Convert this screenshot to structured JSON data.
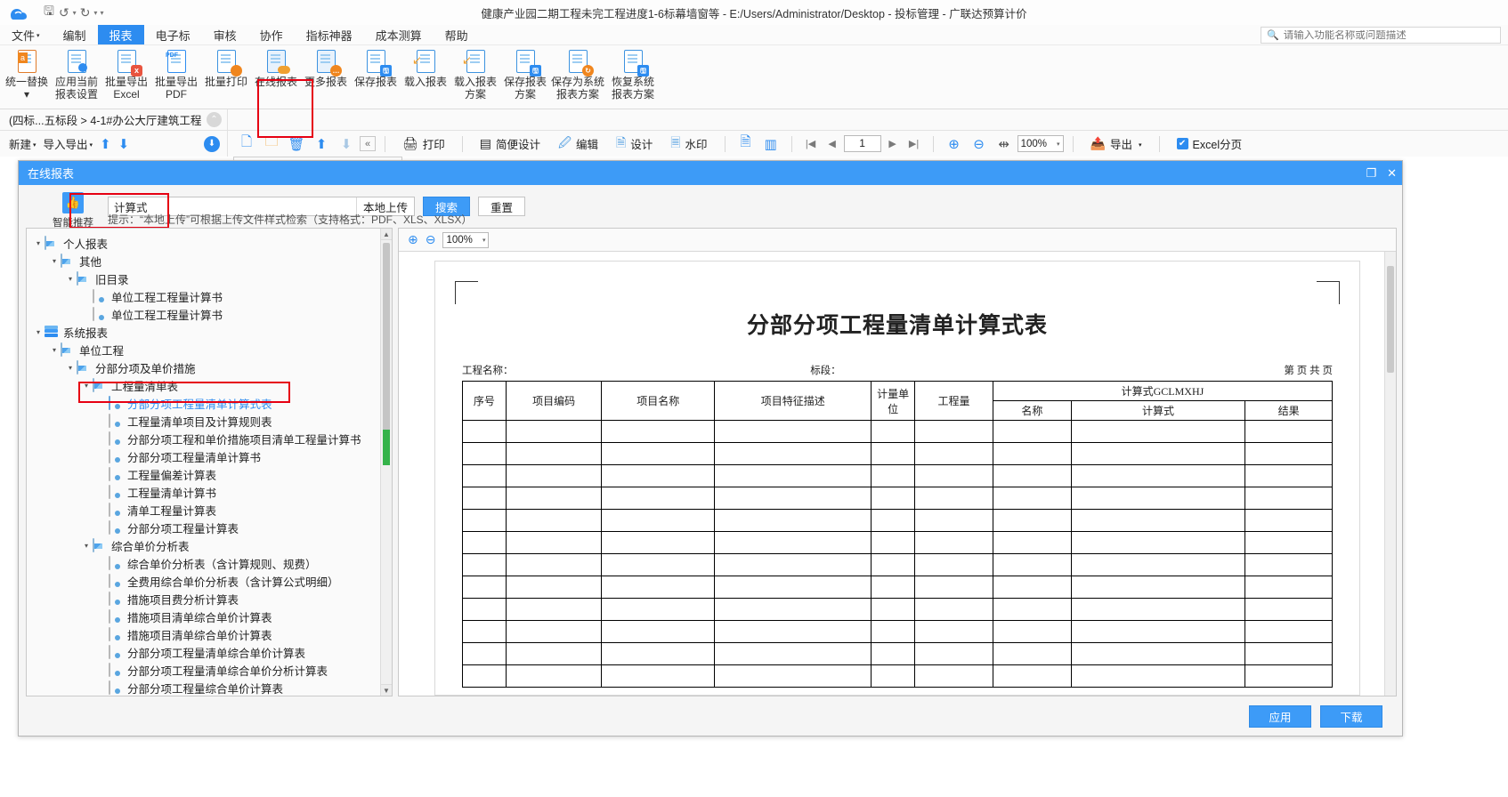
{
  "window": {
    "title": "健康产业园二期工程未完工程进度1-6标幕墙窗等 - E:/Users/Administrator/Desktop - 投标管理 - 广联达预算计价",
    "logo": "cloud-logo-icon"
  },
  "quick_access": [
    "save-icon",
    "undo-icon",
    "redo-icon",
    "customize-icon"
  ],
  "global_search": {
    "placeholder": "请输入功能名称或问题描述",
    "icon": "search-icon"
  },
  "menu": {
    "items": [
      {
        "label": "文件",
        "caret": "▾",
        "active": false
      },
      {
        "label": "编制",
        "active": false
      },
      {
        "label": "报表",
        "active": true
      },
      {
        "label": "电子标",
        "active": false
      },
      {
        "label": "审核",
        "active": false
      },
      {
        "label": "协作",
        "active": false
      },
      {
        "label": "指标神器",
        "active": false
      },
      {
        "label": "成本测算",
        "active": false
      },
      {
        "label": "帮助",
        "active": false
      }
    ]
  },
  "ribbon": {
    "buttons": [
      {
        "label": "统一替换\n▾",
        "icon": "replace-icon",
        "highlight": false
      },
      {
        "label": "应用当前\n报表设置",
        "icon": "apply-settings-icon",
        "highlight": false
      },
      {
        "label": "批量导出\nExcel",
        "icon": "export-excel-icon",
        "highlight": false
      },
      {
        "label": "批量导出\nPDF",
        "icon": "export-pdf-icon",
        "highlight": false
      },
      {
        "label": "批量打印",
        "icon": "batch-print-icon",
        "highlight": false
      },
      {
        "label": "在线报表",
        "icon": "online-report-icon",
        "highlight": true
      },
      {
        "label": "更多报表",
        "icon": "more-report-icon",
        "highlight": false
      },
      {
        "label": "保存报表",
        "icon": "save-report-icon",
        "highlight": false
      },
      {
        "label": "载入报表",
        "icon": "load-report-icon",
        "highlight": false
      },
      {
        "label": "载入报表\n方案",
        "icon": "load-scheme-icon",
        "highlight": false
      },
      {
        "label": "保存报表\n方案",
        "icon": "save-scheme-icon",
        "highlight": false
      },
      {
        "label": "保存为系统\n报表方案",
        "icon": "save-system-scheme-icon",
        "highlight": false
      },
      {
        "label": "恢复系统\n报表方案",
        "icon": "restore-scheme-icon",
        "highlight": false
      }
    ]
  },
  "breadcrumb": {
    "text": "(四标...五标段 > 4-1#办公大厅建筑工程",
    "collapse_icon": "chevron-up-icon"
  },
  "toolbar_left": {
    "new_label": "新建",
    "import_export_label": "导入导出",
    "move_up_icon": "arrow-up-icon",
    "move_down_icon": "arrow-down-icon",
    "download_icon": "download-circle-icon"
  },
  "toolbar_right": {
    "icons": [
      "add-doc-icon",
      "add-folder-icon",
      "delete-icon",
      "move-up-icon",
      "move-down-icon",
      "collapse-icon"
    ],
    "print_label": "打印",
    "simple_design_label": "简便设计",
    "edit_label": "编辑",
    "design_label": "设计",
    "watermark_label": "水印",
    "page_single_icon": "single-page-icon",
    "page_double_icon": "double-page-icon",
    "nav_first": "|◀",
    "nav_prev": "◀",
    "page_value": "1",
    "nav_next": "▶",
    "nav_last": "▶|",
    "zoom_in_icon": "zoom-in-icon",
    "zoom_out_icon": "zoom-out-icon",
    "fit_width_icon": "fit-width-icon",
    "zoom_value": "100%",
    "export_label": "导出",
    "excel_paging_label": "Excel分页",
    "excel_paging_checked": true
  },
  "dialog": {
    "title": "在线报表",
    "minimize_icon": "minimize-icon",
    "close_icon": "close-icon",
    "smart_recommend_label": "智能推荐",
    "smart_recommend_icon": "thumbs-up-icon",
    "search_value": "计算式",
    "local_upload_label": "本地上传",
    "search_button": "搜索",
    "reset_button": "重置",
    "hint": "提示：“本地上传”可根据上传文件样式检索（支持格式：PDF、XLS、XLSX）",
    "apply_button": "应用",
    "download_button": "下载"
  },
  "tree": [
    {
      "level": 0,
      "label": "个人报表",
      "icon": "folder-icon",
      "twisty": "▾",
      "selected": false
    },
    {
      "level": 1,
      "label": "其他",
      "icon": "folder-icon",
      "twisty": "▾",
      "selected": false
    },
    {
      "level": 2,
      "label": "旧目录",
      "icon": "folder-icon",
      "twisty": "▾",
      "selected": false
    },
    {
      "level": 3,
      "label": "单位工程工程量计算书",
      "icon": "report-icon",
      "twisty": "",
      "selected": false
    },
    {
      "level": 3,
      "label": "单位工程工程量计算书",
      "icon": "report-icon",
      "twisty": "",
      "selected": false
    },
    {
      "level": 0,
      "label": "系统报表",
      "icon": "stack-icon",
      "twisty": "▾",
      "selected": false
    },
    {
      "level": 1,
      "label": "单位工程",
      "icon": "folder-icon",
      "twisty": "▾",
      "selected": false
    },
    {
      "level": 2,
      "label": "分部分项及单价措施",
      "icon": "folder-icon",
      "twisty": "▾",
      "selected": false
    },
    {
      "level": 3,
      "label": "工程量清单表",
      "icon": "folder-icon",
      "twisty": "▾",
      "selected": false
    },
    {
      "level": 4,
      "label": "分部分项工程量清单计算式表",
      "icon": "report-icon",
      "twisty": "",
      "selected": true
    },
    {
      "level": 4,
      "label": "工程量清单项目及计算规则表",
      "icon": "report-icon",
      "twisty": "",
      "selected": false
    },
    {
      "level": 4,
      "label": "分部分项工程和单价措施项目清单工程量计算书",
      "icon": "report-icon",
      "twisty": "",
      "selected": false
    },
    {
      "level": 4,
      "label": "分部分项工程量清单计算书",
      "icon": "report-icon",
      "twisty": "",
      "selected": false
    },
    {
      "level": 4,
      "label": "工程量偏差计算表",
      "icon": "report-icon",
      "twisty": "",
      "selected": false
    },
    {
      "level": 4,
      "label": "工程量清单计算书",
      "icon": "report-icon",
      "twisty": "",
      "selected": false
    },
    {
      "level": 4,
      "label": "清单工程量计算表",
      "icon": "report-icon",
      "twisty": "",
      "selected": false
    },
    {
      "level": 4,
      "label": "分部分项工程量计算表",
      "icon": "report-icon",
      "twisty": "",
      "selected": false
    },
    {
      "level": 3,
      "label": "综合单价分析表",
      "icon": "folder-icon",
      "twisty": "▾",
      "selected": false
    },
    {
      "level": 4,
      "label": "综合单价分析表（含计算规则、规费）",
      "icon": "report-icon",
      "twisty": "",
      "selected": false
    },
    {
      "level": 4,
      "label": "全费用综合单价分析表（含计算公式明细）",
      "icon": "report-icon",
      "twisty": "",
      "selected": false
    },
    {
      "level": 4,
      "label": "措施项目费分析计算表",
      "icon": "report-icon",
      "twisty": "",
      "selected": false
    },
    {
      "level": 4,
      "label": "措施项目清单综合单价计算表",
      "icon": "report-icon",
      "twisty": "",
      "selected": false
    },
    {
      "level": 4,
      "label": "措施项目清单综合单价计算表",
      "icon": "report-icon",
      "twisty": "",
      "selected": false
    },
    {
      "level": 4,
      "label": "分部分项工程量清单综合单价计算表",
      "icon": "report-icon",
      "twisty": "",
      "selected": false
    },
    {
      "level": 4,
      "label": "分部分项工程量清单综合单价分析计算表",
      "icon": "report-icon",
      "twisty": "",
      "selected": false
    },
    {
      "level": 4,
      "label": "分部分项工程量综合单价计算表",
      "icon": "report-icon",
      "twisty": "",
      "selected": false
    }
  ],
  "preview": {
    "zoom_in_icon": "zoom-in-icon",
    "zoom_out_icon": "zoom-out-icon",
    "zoom_value": "100%",
    "report": {
      "title": "分部分项工程量清单计算式表",
      "meta_project": "工程名称：",
      "meta_section": "标段：",
      "meta_page": "第  页  共  页",
      "group_header": "计算式GCLMXHJ",
      "columns_top": [
        "序号",
        "项目编码",
        "项目名称",
        "项目特征描述",
        "计量单位",
        "工程量"
      ],
      "columns_group": [
        "名称",
        "计算式",
        "结果"
      ],
      "empty_rows": 12
    }
  },
  "colors": {
    "accent": "#2d8cf0",
    "dialog_title": "#3d9bf7",
    "highlight_box": "#e60012",
    "selected_text": "#2d8cf0"
  }
}
